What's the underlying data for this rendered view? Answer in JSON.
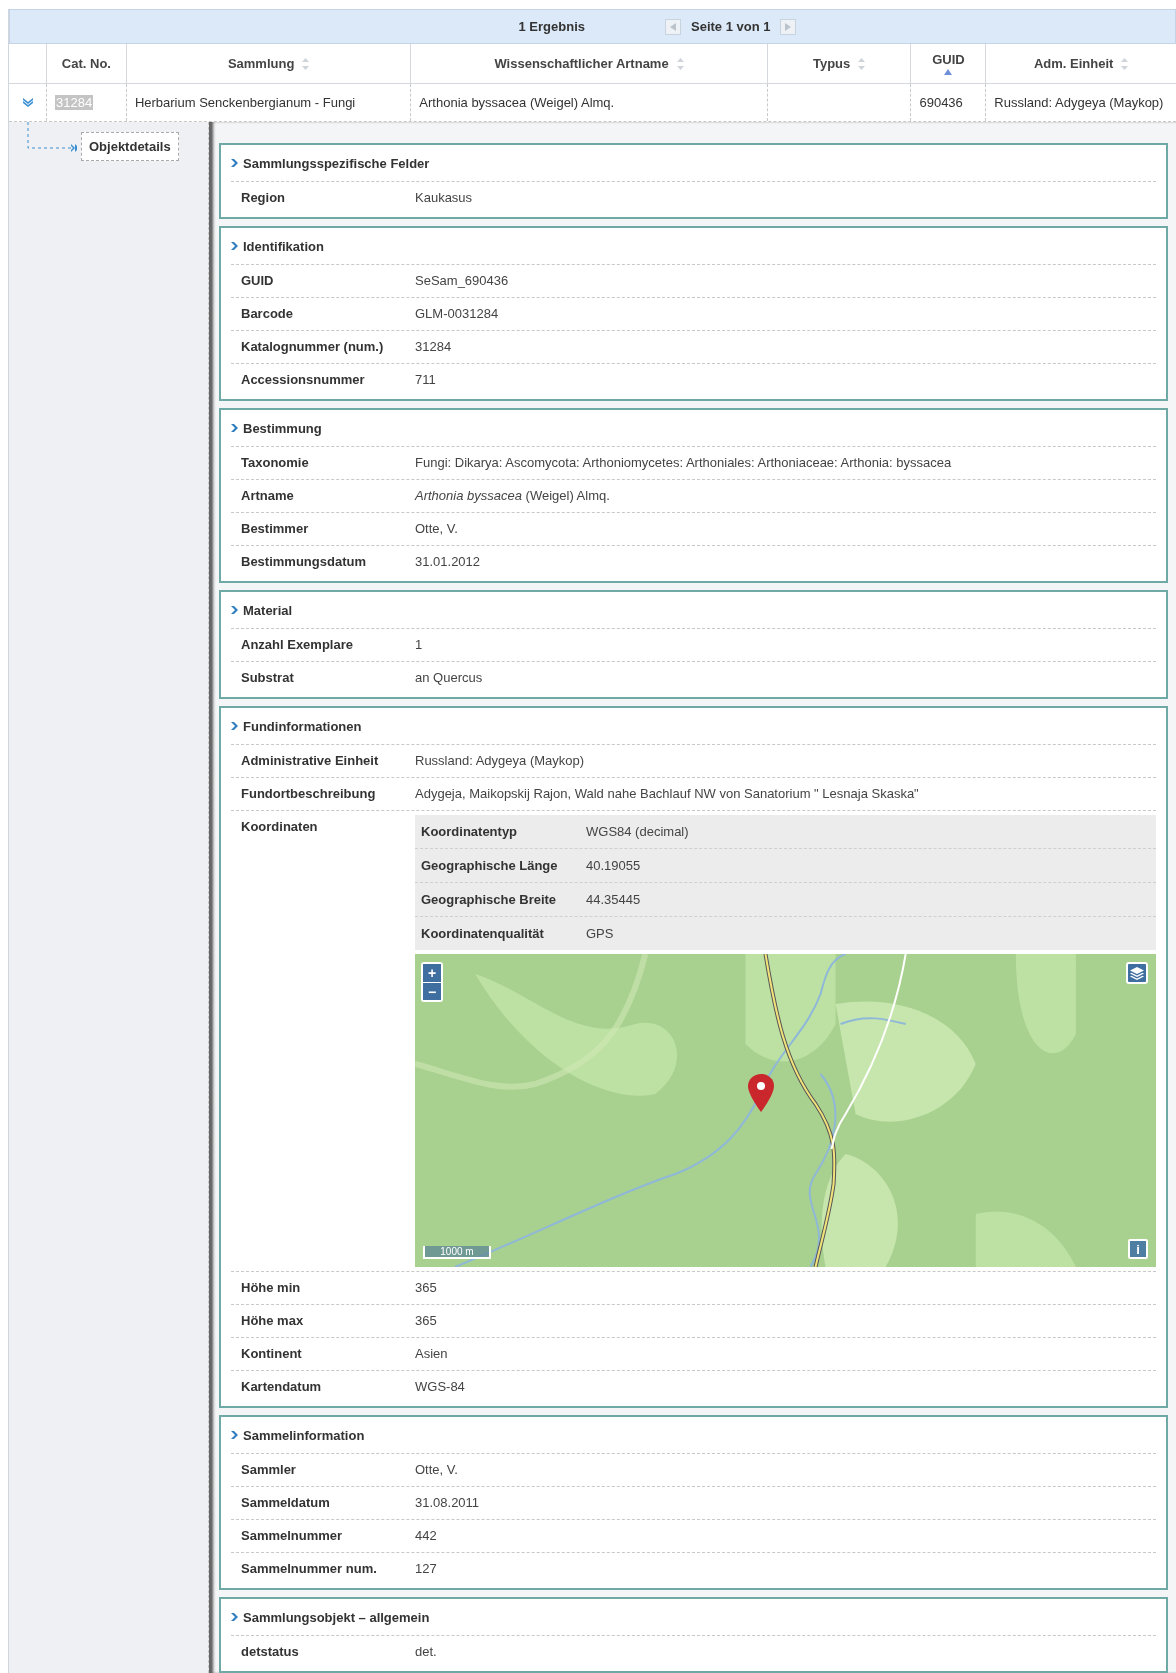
{
  "pager": {
    "result_count": "1 Ergebnis",
    "prev_disabled": true,
    "page": "Seite 1 von 1",
    "next_disabled": true
  },
  "table": {
    "columns": [
      {
        "label": "Cat. No.",
        "sortable": false
      },
      {
        "label": "Sammlung",
        "sortable": true,
        "sorted_ascending": false
      },
      {
        "label": "Wissenschaftlicher Artname",
        "sortable": true,
        "sorted_ascending": false
      },
      {
        "label": "Typus",
        "sortable": true,
        "sorted_ascending": false
      },
      {
        "label": "GUID",
        "sortable": true,
        "sorted_ascending": true
      },
      {
        "label": "Adm. Einheit",
        "sortable": true,
        "sorted_ascending": false
      }
    ],
    "rows": [
      {
        "expanded": true,
        "cat_no_highlighted": true,
        "cells": [
          "31284",
          "Herbarium Senckenbergianum - Fungi",
          "Arthonia byssacea (Weigel) Almq.",
          "",
          "690436",
          "Russland: Adygeya (Maykop)"
        ]
      }
    ]
  },
  "detail_link": "Objektdetails",
  "sections": [
    {
      "title": "Sammlungsspezifische Felder",
      "fields": [
        {
          "kind": "text",
          "label": "Region",
          "value": "Kaukasus"
        }
      ]
    },
    {
      "title": "Identifikation",
      "fields": [
        {
          "kind": "text",
          "label": "GUID",
          "value": "SeSam_690436"
        },
        {
          "kind": "text",
          "label": "Barcode",
          "value": "GLM-0031284"
        },
        {
          "kind": "text",
          "label": "Katalognummer (num.)",
          "value": "31284"
        },
        {
          "kind": "text",
          "label": "Accessionsnummer",
          "value": "711"
        }
      ]
    },
    {
      "title": "Bestimmung",
      "fields": [
        {
          "kind": "text",
          "label": "Taxonomie",
          "value": "Fungi: Dikarya: Ascomycota: Arthoniomycetes: Arthoniales: Arthoniaceae: Arthonia: byssacea"
        },
        {
          "kind": "text",
          "label": "Artname",
          "value": "*Arthonia byssacea* (Weigel) Almq."
        },
        {
          "kind": "text",
          "label": "Bestimmer",
          "value": "Otte, V."
        },
        {
          "kind": "text",
          "label": "Bestimmungsdatum",
          "value": "31.01.2012"
        }
      ]
    },
    {
      "title": "Material",
      "fields": [
        {
          "kind": "text",
          "label": "Anzahl Exemplare",
          "value": "1"
        },
        {
          "kind": "text",
          "label": "Substrat",
          "value": "an Quercus"
        }
      ]
    },
    {
      "title": "Fundinformationen",
      "fields": [
        {
          "kind": "text",
          "label": "Administrative Einheit",
          "value": "Russland: Adygeya (Maykop)"
        },
        {
          "kind": "text",
          "label": "Fundortbeschreibung",
          "value": "Adygeja, Maikopskij Rajon, Wald nahe Bachlauf NW von Sanatorium \" Lesnaja Skaska\""
        },
        {
          "kind": "coordinates",
          "label": "Koordinaten",
          "subfields": [
            {
              "label": "Koordinatentyp",
              "value": "WGS84 (decimal)"
            },
            {
              "label": "Geographische Länge",
              "value": "40.19055"
            },
            {
              "label": "Geographische Breite",
              "value": "44.35445"
            },
            {
              "label": "Koordinatenqualität",
              "value": "GPS"
            }
          ],
          "map": {
            "zoom_in": "+",
            "zoom_out": "−",
            "scale": "1000 m",
            "info": "i"
          }
        },
        {
          "kind": "text",
          "label": "Höhe min",
          "value": "365"
        },
        {
          "kind": "text",
          "label": "Höhe max",
          "value": "365"
        },
        {
          "kind": "text",
          "label": "Kontinent",
          "value": "Asien"
        },
        {
          "kind": "text",
          "label": "Kartendatum",
          "value": "WGS-84"
        }
      ]
    },
    {
      "title": "Sammelinformation",
      "fields": [
        {
          "kind": "text",
          "label": "Sammler",
          "value": "Otte, V."
        },
        {
          "kind": "text",
          "label": "Sammeldatum",
          "value": "31.08.2011"
        },
        {
          "kind": "text",
          "label": "Sammelnummer",
          "value": "442"
        },
        {
          "kind": "text",
          "label": "Sammelnummer num.",
          "value": "127"
        }
      ]
    },
    {
      "title": "Sammlungsobjekt – allgemein",
      "fields": [
        {
          "kind": "text",
          "label": "detstatus",
          "value": "det."
        }
      ]
    }
  ]
}
